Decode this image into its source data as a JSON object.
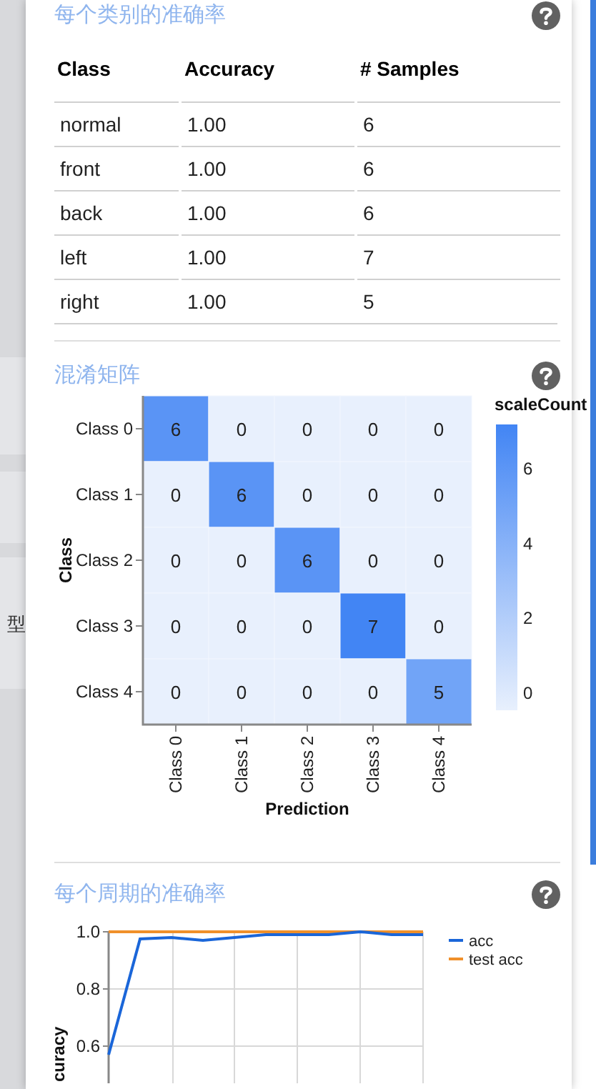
{
  "sidebar": {
    "items": [
      {
        "label": "型"
      }
    ]
  },
  "accuracy_per_class": {
    "title": "每个类别的准确率",
    "columns": [
      "Class",
      "Accuracy",
      "# Samples"
    ],
    "rows": [
      [
        "normal",
        "1.00",
        "6"
      ],
      [
        "front",
        "1.00",
        "6"
      ],
      [
        "back",
        "1.00",
        "6"
      ],
      [
        "left",
        "1.00",
        "7"
      ],
      [
        "right",
        "1.00",
        "5"
      ]
    ]
  },
  "confusion_matrix": {
    "title": "混淆矩阵",
    "y_axis_label": "Class",
    "x_axis_label": "Prediction",
    "row_labels": [
      "Class 0",
      "Class 1",
      "Class 2",
      "Class 3",
      "Class 4"
    ],
    "column_labels": [
      "Class 0",
      "Class 1",
      "Class 2",
      "Class 3",
      "Class 4"
    ],
    "cells": [
      [
        "6",
        "0",
        "0",
        "0",
        "0"
      ],
      [
        "0",
        "6",
        "0",
        "0",
        "0"
      ],
      [
        "0",
        "0",
        "6",
        "0",
        "0"
      ],
      [
        "0",
        "0",
        "0",
        "7",
        "0"
      ],
      [
        "0",
        "0",
        "0",
        "0",
        "5"
      ]
    ],
    "legend": {
      "title": "scaleCount",
      "ticks": [
        "6",
        "4",
        "2",
        "0"
      ]
    }
  },
  "accuracy_per_epoch": {
    "title": "每个周期的准确率",
    "chart_data": {
      "type": "line",
      "ylabel": "curacy",
      "ylim": [
        0.47,
        1.0
      ],
      "grid": true,
      "legend": true,
      "yticks": [
        {
          "value": 0.6,
          "label": "0.6"
        },
        {
          "value": 0.8,
          "label": "0.8"
        },
        {
          "value": 1,
          "label": "1.0"
        }
      ],
      "series": [
        {
          "name": "acc",
          "color": "#1a66d9",
          "values": [
            0.57,
            0.975,
            0.98,
            0.97,
            0.98,
            0.99,
            0.99,
            0.99,
            1.0,
            0.99,
            0.99
          ]
        },
        {
          "name": "test acc",
          "color": "#f0902a",
          "values": [
            1,
            1,
            1,
            1,
            1,
            1,
            1,
            1,
            1,
            1,
            1
          ]
        }
      ]
    }
  }
}
